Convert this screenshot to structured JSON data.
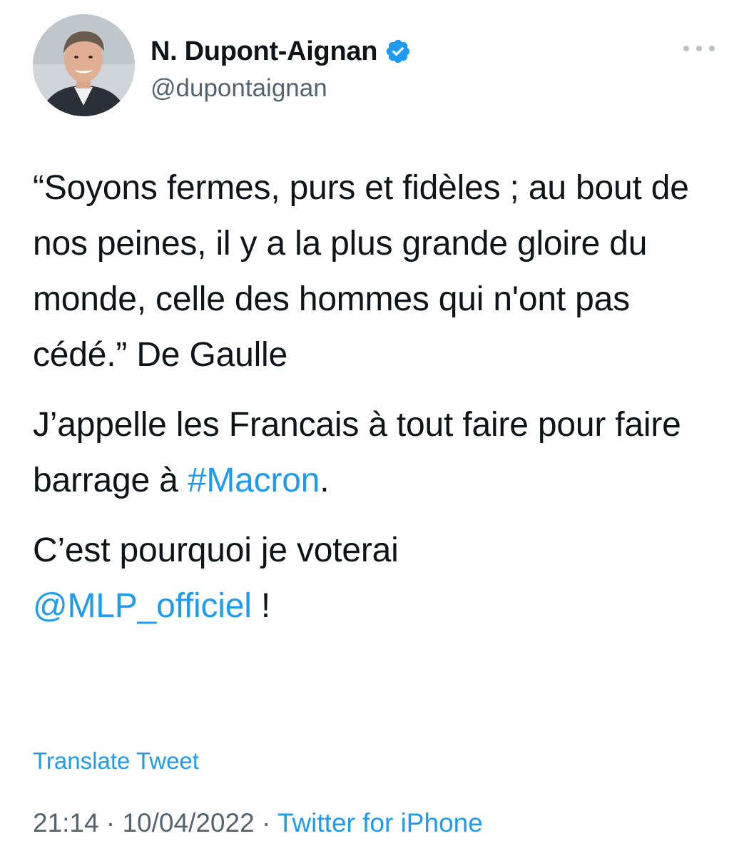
{
  "author": {
    "display_name": "N. Dupont-Aignan",
    "handle": "@dupontaignan",
    "avatar_icon": "avatar-photo",
    "verified_icon": "verified-badge-icon",
    "verified_color": "#1d9bf0"
  },
  "more_icon": "more-options-icon",
  "tweet": {
    "quote": {
      "text": "“Soyons fermes, purs et fidèles ; au bout de nos peines, il y a la plus grande gloire du monde, celle des hommes qui n'ont pas cédé.” De Gaulle"
    },
    "call": {
      "before": "J’appelle les Francais à tout faire pour faire barrage à ",
      "hashtag": "#Macron",
      "after": "."
    },
    "vote": {
      "before": "C’est pourquoi je voterai ",
      "mention": "@MLP_officiel",
      "after": " !"
    }
  },
  "translate_label": "Translate Tweet",
  "meta": {
    "time": "21:14",
    "separator": " · ",
    "date": "10/04/2022",
    "source": "Twitter for iPhone"
  },
  "colors": {
    "text": "#0f1419",
    "secondary": "#536471",
    "link": "#1d9bf0"
  }
}
